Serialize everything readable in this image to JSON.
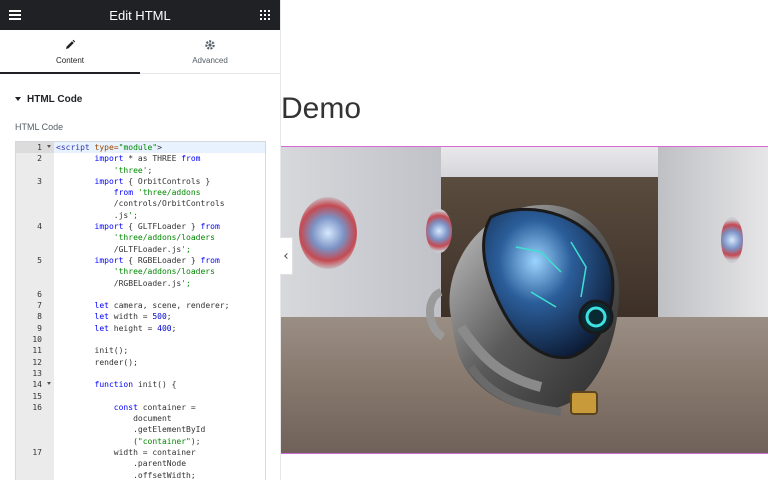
{
  "topbar": {
    "title": "Edit HTML"
  },
  "tabs": [
    {
      "label": "Content",
      "icon": "pencil-icon",
      "active": true
    },
    {
      "label": "Advanced",
      "icon": "gear-icon",
      "active": false
    }
  ],
  "section": {
    "title": "HTML Code",
    "field_label": "HTML Code"
  },
  "editor": {
    "lines": [
      {
        "num": "1",
        "fold": true,
        "text": "<script type=\"module\">"
      },
      {
        "num": "2",
        "text": "        import * as THREE from"
      },
      {
        "num": "",
        "text": "            'three';"
      },
      {
        "num": "3",
        "text": "        import { OrbitControls }"
      },
      {
        "num": "",
        "text": "            from 'three/addons"
      },
      {
        "num": "",
        "text": "            /controls/OrbitControls"
      },
      {
        "num": "",
        "text": "            .js';"
      },
      {
        "num": "4",
        "text": "        import { GLTFLoader } from"
      },
      {
        "num": "",
        "text": "            'three/addons/loaders"
      },
      {
        "num": "",
        "text": "            /GLTFLoader.js';"
      },
      {
        "num": "5",
        "text": "        import { RGBELoader } from"
      },
      {
        "num": "",
        "text": "            'three/addons/loaders"
      },
      {
        "num": "",
        "text": "            /RGBELoader.js';"
      },
      {
        "num": "",
        "text": ""
      },
      {
        "num": "6",
        "text": ""
      },
      {
        "num": "7",
        "text": "        let camera, scene, renderer;"
      },
      {
        "num": "8",
        "text": "        let width = 500;"
      },
      {
        "num": "9",
        "text": "        let height = 400;"
      },
      {
        "num": "10",
        "text": ""
      },
      {
        "num": "11",
        "text": "        init();"
      },
      {
        "num": "12",
        "text": "        render();"
      },
      {
        "num": "13",
        "text": ""
      },
      {
        "num": "14",
        "fold": true,
        "text": "        function init() {"
      },
      {
        "num": "15",
        "text": ""
      },
      {
        "num": "16",
        "text": "            const container ="
      },
      {
        "num": "",
        "text": "                document"
      },
      {
        "num": "",
        "text": "                .getElementById"
      },
      {
        "num": "",
        "text": "                (\"container\");"
      },
      {
        "num": "17",
        "text": "            width = container"
      },
      {
        "num": "",
        "text": "                .parentNode"
      },
      {
        "num": "",
        "text": "                .offsetWidth;"
      }
    ]
  },
  "canvas": {
    "title": "Demo"
  }
}
